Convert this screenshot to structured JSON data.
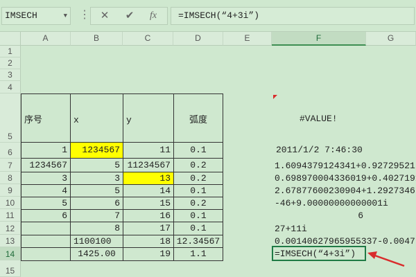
{
  "formula_bar": {
    "name_box": "IMSECH",
    "formula_text": "=IMSECH(“4+3i”)",
    "cancel_glyph": "✕",
    "enter_glyph": "✔",
    "fx_label": "fx",
    "more_glyph": "⋮"
  },
  "columns": [
    "A",
    "B",
    "C",
    "D",
    "E",
    "F",
    "G"
  ],
  "rows": [
    "1",
    "2",
    "3",
    "4",
    "5",
    "6",
    "7",
    "8",
    "9",
    "10",
    "11",
    "12",
    "13",
    "14",
    "15"
  ],
  "table": {
    "headers": {
      "a": "序号",
      "b": "x",
      "c": "y",
      "d": "弧度"
    },
    "body": [
      {
        "a": "1",
        "b": "1234567",
        "c": "11",
        "d": "0.1"
      },
      {
        "a": "1234567",
        "b": "5",
        "c": "11234567",
        "d": "0.2"
      },
      {
        "a": "3",
        "b": "3",
        "c": "13",
        "d": "0.2"
      },
      {
        "a": "4",
        "b": "5",
        "c": "14",
        "d": "0.1"
      },
      {
        "a": "5",
        "b": "6",
        "c": "15",
        "d": "0.2"
      },
      {
        "a": "6",
        "b": "7",
        "c": "16",
        "d": "0.1"
      },
      {
        "a": "",
        "b": "8",
        "c": "17",
        "d": "0.1"
      },
      {
        "a": "",
        "b": "1100100",
        "c": "18",
        "d": "12.34567"
      },
      {
        "a": "",
        "b": "1425.00",
        "c": "19",
        "d": "1.1"
      }
    ]
  },
  "column_f": {
    "r5": "#VALUE!",
    "r6": "2011/1/2 7:46:30",
    "r7": "1.6094379124341+0.92729521",
    "r8": "0.698970004336019+0.4027191",
    "r9": "2.67877600230904+1.2927346",
    "r10": "-46+9.00000000000001i",
    "r11": "6",
    "r12": "27+11i",
    "r13": "0.00140627965955337-0.0047",
    "r14": "=IMSECH(“4+3i”)"
  },
  "colors": {
    "background": "#cfe8cf",
    "highlight": "#ffff00",
    "active_border": "#1f7a45",
    "arrow": "#d92c2c"
  }
}
